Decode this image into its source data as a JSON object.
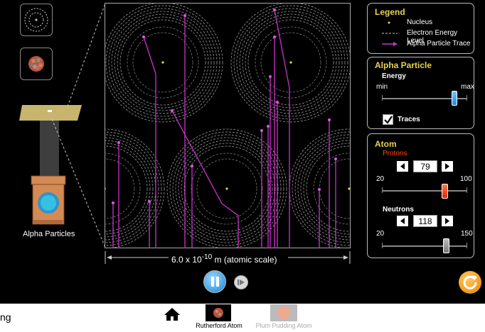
{
  "left": {
    "gun_label": "Alpha Particles",
    "thumb_top": "atom-view-icon",
    "thumb_bottom": "nucleus-view-icon"
  },
  "scale": {
    "label_pre": "6.0 x 10",
    "label_exp": "-10",
    "label_post": " m (atomic scale)"
  },
  "legend": {
    "title": "Legend",
    "items": [
      {
        "icon": "nucleus-dot-icon",
        "label": "Nucleus"
      },
      {
        "icon": "dashed-line-icon",
        "label": "Electron Energy Level"
      },
      {
        "icon": "trace-arrow-icon",
        "label": "Alpha Particle Trace"
      }
    ]
  },
  "alpha": {
    "title": "Alpha Particle",
    "energy_label": "Energy",
    "min": "min",
    "max": "max",
    "energy_level": 0.85,
    "traces_label": "Traces",
    "traces_checked": true
  },
  "atom": {
    "title": "Atom",
    "protons_label": "Protons",
    "protons": "79",
    "protons_min": "20",
    "protons_max": "100",
    "neutrons_label": "Neutrons",
    "neutrons": "118",
    "neutrons_min": "20",
    "neutrons_max": "150"
  },
  "nav": {
    "home_icon": "home-icon",
    "screens": [
      "Rutherford Atom",
      "Plum Pudding Atom"
    ]
  },
  "footer_fragment": "ng",
  "colors": {
    "accent": "#e6d34a",
    "proton": "#ff4a1a",
    "trace": "#cc33cc",
    "play": "#4aa8e8",
    "reset": "#f4a020"
  }
}
